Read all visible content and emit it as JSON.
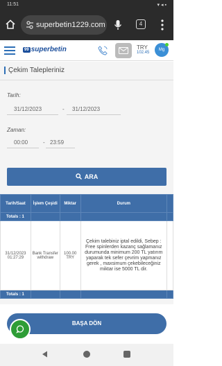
{
  "status_bar": {
    "time": "11:51",
    "icons": "▾◂▪"
  },
  "browser": {
    "url": "superbetin1229.com",
    "tab_count": "4"
  },
  "header": {
    "logo_badge": "99",
    "logo_text": "superbetin",
    "currency": "TRY",
    "balance": "102.45",
    "avatar_initials": "Mg"
  },
  "page": {
    "title": "Çekim Talepleriniz"
  },
  "filters": {
    "date_label": "Tarih:",
    "date_from": "31/12/2023",
    "date_to": "31/12/2023",
    "time_label": "Zaman:",
    "time_from": "00:00",
    "time_to": "23:59",
    "separator": "-"
  },
  "search_button": "ARA",
  "table": {
    "headers": [
      "Tarih/Saat",
      "İşlem Çeşidi",
      "Miktar",
      "Durum"
    ],
    "totals_label": "Totals : 1",
    "row": {
      "datetime": "31/12/2023 01:27:29",
      "type": "Bank Transfer withdraw",
      "amount": "100.00 TRY",
      "status": "Çekim talebiniz iptal edildi, Sebep : Free spinlerden kazanç sağlamanız durumunda minimum 200 TL yatırım yaparak tek sefer çevrim yapmanız gerek , maxsimum çekebileceğiniz miktar ise 5000 TL dir."
    }
  },
  "back_button": "BAŞA DÖN",
  "colors": {
    "primary": "#3f6ea8",
    "chat": "#2e9d36"
  }
}
